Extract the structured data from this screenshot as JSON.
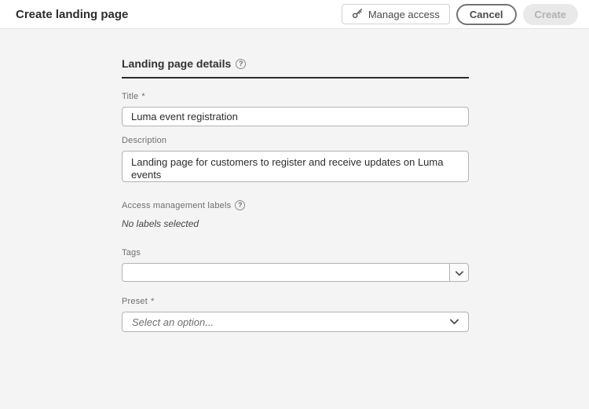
{
  "header": {
    "title": "Create landing page",
    "manage_access": {
      "label": "Manage access"
    },
    "cancel": {
      "label": "Cancel"
    },
    "create": {
      "label": "Create"
    }
  },
  "form": {
    "section": {
      "title": "Landing page details"
    },
    "title_field": {
      "label": "Title",
      "required_mark": "*",
      "value": "Luma event registration"
    },
    "description_field": {
      "label": "Description",
      "value": "Landing page for customers to register and receive updates on Luma events"
    },
    "access_labels_field": {
      "label": "Access management labels",
      "empty_text": "No labels selected"
    },
    "tags_field": {
      "label": "Tags",
      "value": ""
    },
    "preset_field": {
      "label": "Preset",
      "required_mark": "*",
      "placeholder": "Select an option..."
    }
  },
  "icons": {
    "help_glyph": "?",
    "key": "key-icon",
    "chevron_down": "chevron-down-icon"
  },
  "colors": {
    "page_bg": "#f4f4f4",
    "header_bg": "#ffffff",
    "header_border": "#e3e3e3",
    "section_rule": "#2c2c2c",
    "field_border": "#b3b3b3",
    "label_text": "#6e6e6e",
    "value_text": "#2c2c2c",
    "disabled_bg": "#e9e9e9",
    "disabled_text": "#b1b1b1"
  }
}
